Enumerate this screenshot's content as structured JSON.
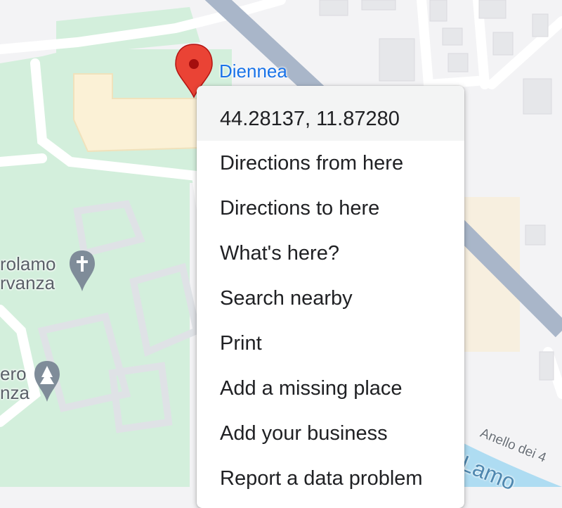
{
  "map": {
    "pin_label": "Diennea",
    "poi_labels": [
      {
        "lines": [
          "rolamo",
          "rvanza"
        ],
        "icon": "cross-icon"
      },
      {
        "lines": [
          "ero",
          "nza"
        ],
        "icon": "tree-icon"
      }
    ],
    "road_labels": [
      "Anello dei 4",
      "Lamo"
    ],
    "colors": {
      "background": "#f3f3f5",
      "park": "#cfeed8",
      "building": "#fbf3d8",
      "road": "#ffffff",
      "highway": "#a9b6c9",
      "water": "#aedcf2",
      "marker": "#ea4335",
      "pin_label": "#1a73e8"
    }
  },
  "context_menu": {
    "coordinates": "44.28137, 11.87280",
    "items": [
      "Directions from here",
      "Directions to here",
      "What's here?",
      "Search nearby",
      "Print",
      "Add a missing place",
      "Add your business",
      "Report a data problem"
    ]
  }
}
